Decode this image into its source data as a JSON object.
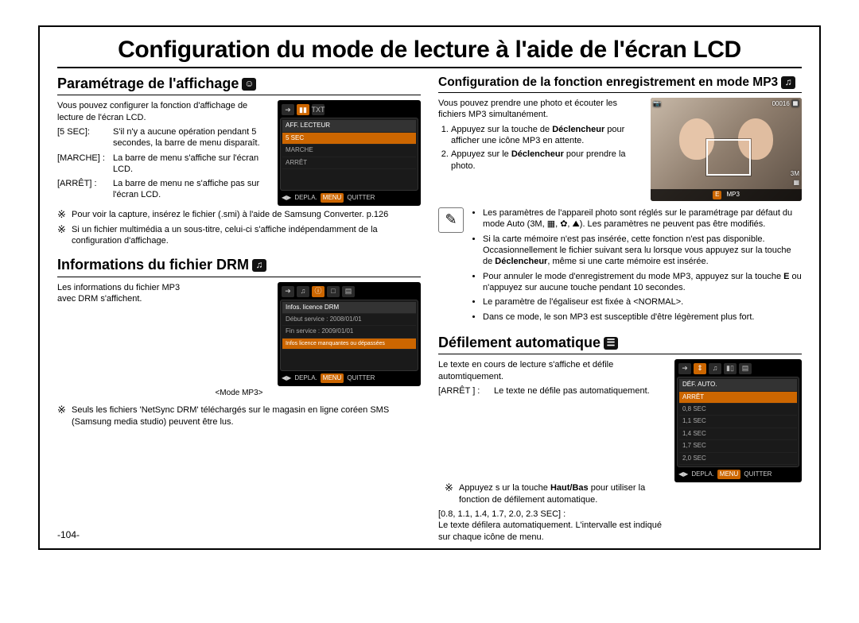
{
  "page_number": "-104-",
  "title": "Configuration du mode de lecture à l'aide de l'écran LCD",
  "left": {
    "h_display": "Paramétrage de l'affichage",
    "intro1": "Vous pouvez configurer la fonction d'affichage de lecture de l'écran LCD.",
    "defs_display": [
      {
        "key": "[5 SEC]:",
        "val": "S'il n'y a aucune opération pendant 5 secondes, la barre de menu disparaît."
      },
      {
        "key": "[MARCHE] :",
        "val": "La barre de menu s'affiche sur l'écran LCD."
      },
      {
        "key": "[ARRÊT] :",
        "val": "La barre de menu ne s'affiche pas sur l'écran LCD."
      }
    ],
    "lcd1_rows": {
      "heading": "AFF. LECTEUR",
      "a": "5 SEC",
      "b": "MARCHE",
      "c": "ARRÊT"
    },
    "note1a": "Pour voir la capture, insérez le fichier (.smi) à l'aide de Samsung Converter. p.126",
    "note1b": "Si un fichier multimédia a un sous-titre, celui-ci s'affiche indépendamment de la configuration d'affichage.",
    "h_drm": "Informations du fichier DRM",
    "intro_drm": "Les informations du fichier MP3 avec DRM s'affichent.",
    "lcd2_rows": {
      "heading": "Infos. licence DRM",
      "a": "Début service : 2008/01/01",
      "b": "Fin service : 2009/01/01",
      "c": "Infos licence manquantes ou dépassées"
    },
    "drm_caption": "<Mode MP3>",
    "note_drm": "Seuls les fichiers 'NetSync DRM' téléchargés sur le magasin en ligne coréen SMS (Samsung media studio) peuvent être lus."
  },
  "right": {
    "h_mp3": "Configuration de la fonction enregistrement en mode MP3",
    "intro_mp3": "Vous pouvez prendre une photo et écouter les fichiers MP3 simultanément.",
    "step1a": "Appuyez sur la touche de ",
    "step1b": "Déclencheur",
    "step1c": " pour afficher une icône MP3 en attente.",
    "step2a": "Appuyez sur le ",
    "step2b": "Déclencheur",
    "step2c": " pour prendre la photo.",
    "photo_tl": "📷",
    "photo_tr": "00016  🔲",
    "photo_br_a": "3M",
    "photo_br_b": "▦",
    "photo_bar_e": "E",
    "photo_bar_mp3": "MP3",
    "bullet1": "Les paramètres de l'appareil photo sont réglés sur le paramétrage par défaut du mode Auto (3M, ▦, ✿, ⛰). Les paramètres ne peuvent pas être modifiés.",
    "bullet2a": "Si la carte mémoire n'est pas insérée, cette fonction n'est pas disponible. Occasionnellement le fichier suivant sera lu lorsque vous appuyez sur la touche de ",
    "bullet2b": "Déclencheur",
    "bullet2c": ", même si une carte mémoire est insérée.",
    "bullet3a": "Pour annuler le mode d'enregistrement du mode MP3, appuyez sur la touche ",
    "bullet3b": "E",
    "bullet3c": " ou n'appuyez sur aucune touche pendant 10 secondes.",
    "bullet4": "Le paramètre de l'égaliseur est fixée à <NORMAL>.",
    "bullet5": "Dans ce mode, le son MP3 est susceptible d'être légèrement plus fort.",
    "h_scroll": "Défilement automatique",
    "intro_scroll": "Le texte en cours de lecture s'affiche et défile automtiquement.",
    "def_scroll1_key": "[ARRÊT ] :",
    "def_scroll1_val": "Le texte ne défile pas automatiquement.",
    "note_scroll_a": "Appuyez s ur la touche ",
    "note_scroll_b": "Haut/Bas",
    "note_scroll_c": " pour utiliser la fonction de défilement automatique.",
    "def_scroll2_key": "[0.8, 1.1, 1.4, 1.7, 2.0, 2.3 SEC] :",
    "def_scroll2_val": "Le texte défilera automatiquement. L'intervalle est indiqué sur chaque icône de menu.",
    "lcd3_rows": {
      "heading": "DÉF. AUTO.",
      "a": "ARRÊT",
      "b": "0,8 SEC",
      "c": "1,1 SEC",
      "d": "1,4 SEC",
      "e": "1,7 SEC",
      "f": "2,0 SEC"
    }
  },
  "lcd_footer": {
    "move": "DEPLA.",
    "menu": "MENU",
    "quit": "QUITTER",
    "arrows": "◀▶"
  }
}
